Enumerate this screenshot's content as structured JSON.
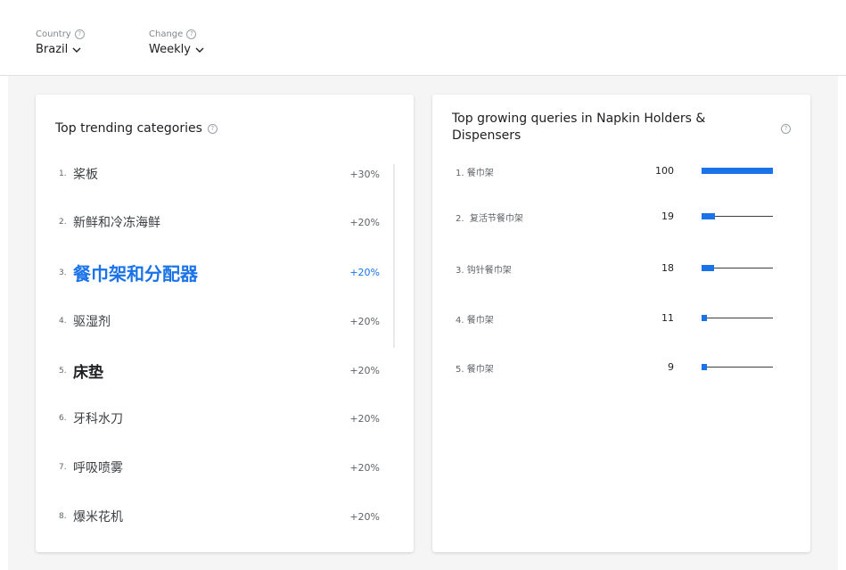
{
  "filters": {
    "country": {
      "label": "Country",
      "value": "Brazil"
    },
    "change": {
      "label": "Change",
      "value": "Weekly"
    }
  },
  "categories_card": {
    "title": "Top trending categories",
    "items": [
      {
        "rank": "1.",
        "name": "桨板",
        "change": "+30%"
      },
      {
        "rank": "2.",
        "name": "新鲜和冷冻海鲜",
        "change": "+20%"
      },
      {
        "rank": "3.",
        "name": "餐巾架和分配器",
        "change": "+20%"
      },
      {
        "rank": "4.",
        "name": "驱湿剂",
        "change": "+20%"
      },
      {
        "rank": "5.",
        "name": "床垫",
        "change": "+20%"
      },
      {
        "rank": "6.",
        "name": "牙科水刀",
        "change": "+20%"
      },
      {
        "rank": "7.",
        "name": "呼吸喷雾",
        "change": "+20%"
      },
      {
        "rank": "8.",
        "name": "爆米花机",
        "change": "+20%"
      }
    ]
  },
  "queries_card": {
    "title": "Top growing queries in Napkin Holders & Dispensers",
    "items": [
      {
        "rank": "1.",
        "name": "餐巾架",
        "value": "100",
        "level": 100
      },
      {
        "rank": "2.",
        "name": "复活节餐巾架",
        "value": "19",
        "level": 19
      },
      {
        "rank": "3.",
        "name": "钩针餐巾架",
        "value": "18",
        "level": 18
      },
      {
        "rank": "4.",
        "name": "餐巾架",
        "value": "11",
        "level": 11
      },
      {
        "rank": "5.",
        "name": "餐巾架",
        "value": "9",
        "level": 9
      }
    ]
  },
  "colors": {
    "accent": "#1a73e8",
    "text": "#3c4043"
  }
}
